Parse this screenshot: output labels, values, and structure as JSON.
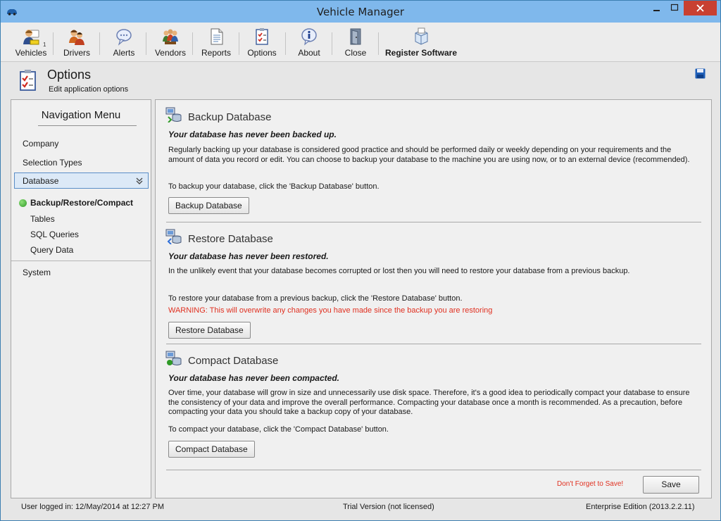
{
  "window": {
    "title": "Vehicle Manager"
  },
  "toolbar": {
    "vehicles": "Vehicles",
    "vehicles_badge": "1",
    "drivers": "Drivers",
    "alerts": "Alerts",
    "vendors": "Vendors",
    "reports": "Reports",
    "options": "Options",
    "about": "About",
    "close": "Close",
    "register": "Register Software"
  },
  "header": {
    "title": "Options",
    "subtitle": "Edit application options"
  },
  "nav": {
    "title": "Navigation Menu",
    "items": [
      "Company",
      "Selection Types",
      "Database",
      "System"
    ],
    "subitems": [
      "Backup/Restore/Compact",
      "Tables",
      "SQL Queries",
      "Query Data"
    ]
  },
  "backup": {
    "title": "Backup Database",
    "status": "Your database has never been backed up.",
    "para1": "Regularly backing up your database is considered good practice and should be performed daily or weekly depending on your requirements and the amount of data you record or edit. You can choose to backup your database to the machine you are using now, or to an external device (recommended).",
    "para2": "To backup your database, click the 'Backup Database' button.",
    "button": "Backup Database"
  },
  "restore": {
    "title": "Restore Database",
    "status": "Your database has never been restored.",
    "para1": "In the unlikely event that your database becomes corrupted or lost then you will need to restore your database from a previous backup.",
    "para2": "To restore your database from a previous backup, click the 'Restore Database' button.",
    "warning": "WARNING: This will overwrite any changes you have made since the backup you are restoring",
    "button": "Restore Database"
  },
  "compact": {
    "title": "Compact Database",
    "status": "Your database has never been compacted.",
    "para1": "Over time, your database will grow in size and unnecessarily use disk space. Therefore, it's a good idea to periodically compact your database to ensure the consistency of your data and improve the overall performance. Compacting your database once a month is recommended. As a precaution, before compacting your data you should take a backup copy of your database.",
    "para2": "To compact your database, click the 'Compact Database' button.",
    "button": "Compact Database"
  },
  "footer": {
    "reminder": "Don't Forget to Save!",
    "save": "Save"
  },
  "status": {
    "user": "User logged in:  12/May/2014 at 12:27 PM",
    "license": "Trial Version (not licensed)",
    "edition": "Enterprise Edition (2013.2.2.11)"
  },
  "colors": {
    "titlebar": "#7fb8ec",
    "close": "#c84031",
    "warning": "#e03020",
    "nav_active_dot": "#2f9a27"
  }
}
